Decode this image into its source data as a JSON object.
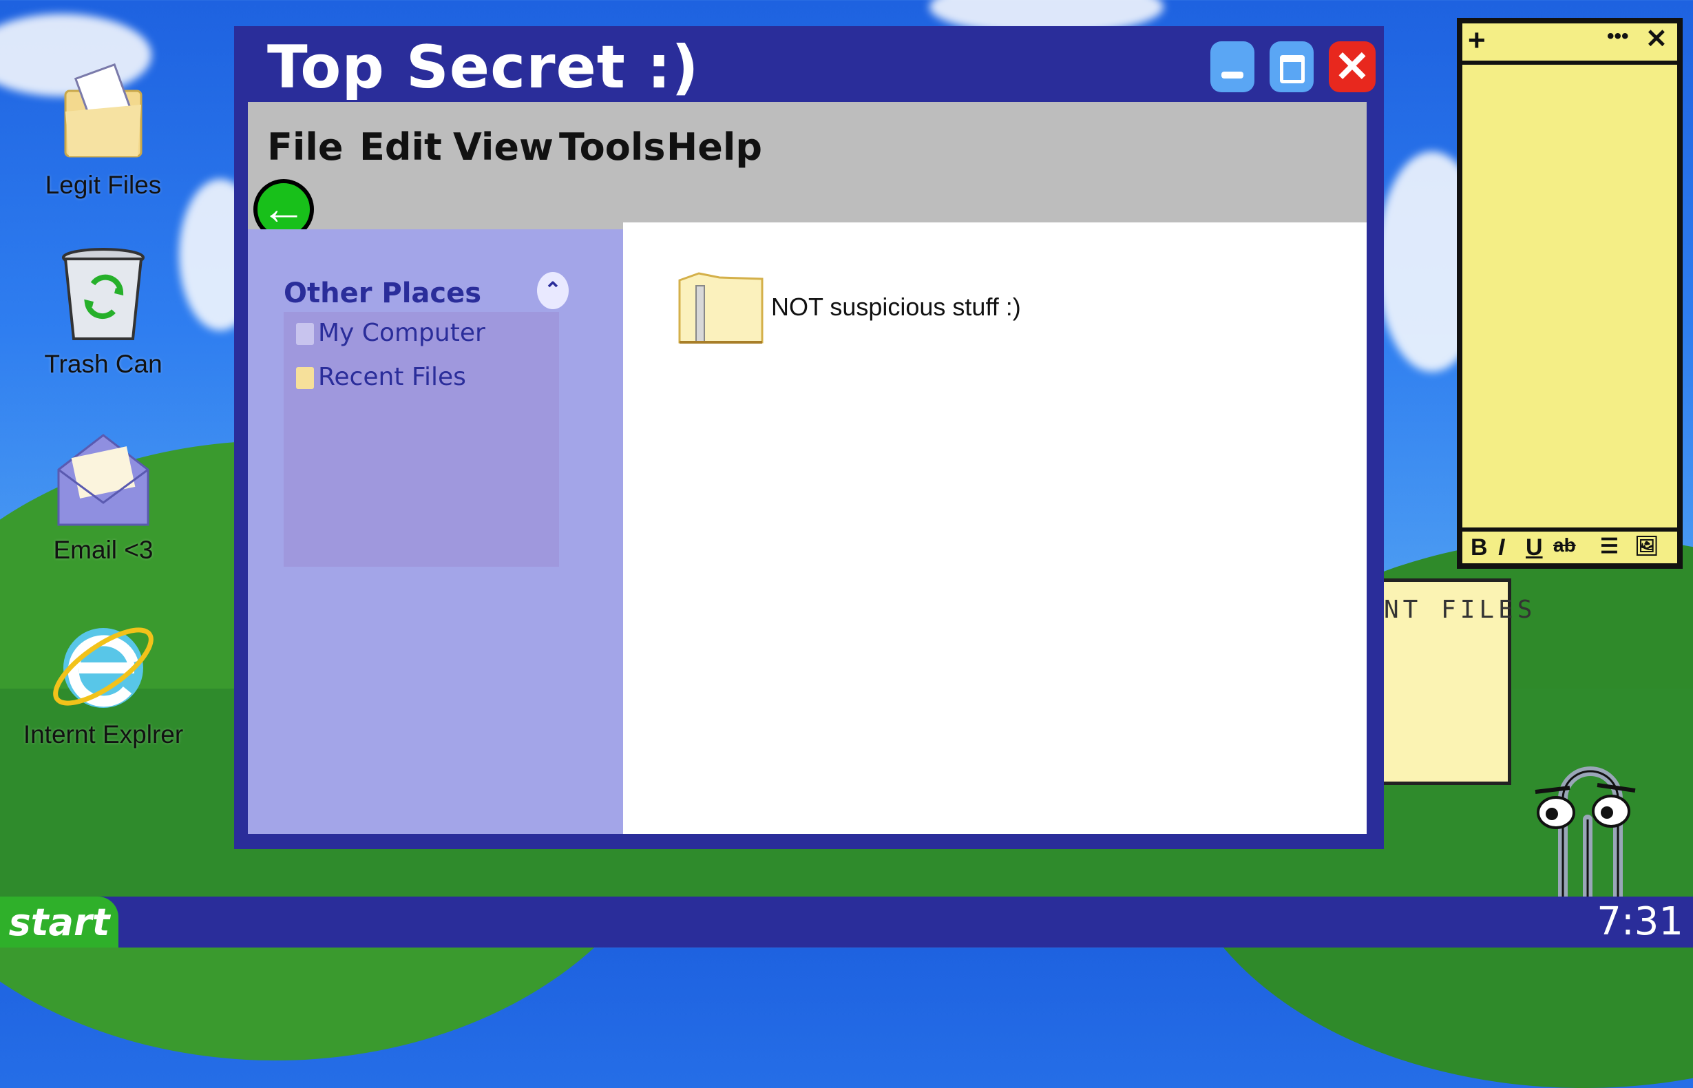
{
  "desktop": {
    "icons": [
      {
        "label": "Legit Files",
        "icon": "folder-icon"
      },
      {
        "label": "Trash Can",
        "icon": "recycle-bin-icon"
      },
      {
        "label": "Email <3",
        "icon": "envelope-icon"
      },
      {
        "label": "Internt Explrer",
        "icon": "browser-icon"
      }
    ]
  },
  "window": {
    "title": "Top Secret :)",
    "controls": {
      "minimize": "minimize-icon",
      "maximize": "maximize-icon",
      "close": "close-icon"
    },
    "menu": [
      "File",
      "Edit",
      "View",
      "Tools",
      "Help"
    ],
    "back_icon": "back-arrow-icon",
    "sidebar": {
      "title": "Other Places",
      "links": [
        "My Computer",
        "Recent Files"
      ]
    },
    "content": {
      "items": [
        {
          "label": "NOT suspicious stuff :)",
          "icon": "folder-icon"
        }
      ]
    }
  },
  "sticky_note": {
    "toolbar_top": [
      "+",
      "•••",
      "✕"
    ],
    "format_buttons": [
      "B",
      "I",
      "U",
      "ab",
      "☰",
      "🖼"
    ]
  },
  "assistant": {
    "bubble_text": "NT FILES"
  },
  "taskbar": {
    "start_label": "start",
    "clock": "7:31"
  },
  "colors": {
    "window": "#2a2d9a",
    "sidebar": "#a3a5e8",
    "menubar": "#bdbdbd",
    "start": "#2fb02a",
    "sticky": "#f4ee86",
    "close": "#e8281e",
    "minmax": "#5aa6f4"
  }
}
